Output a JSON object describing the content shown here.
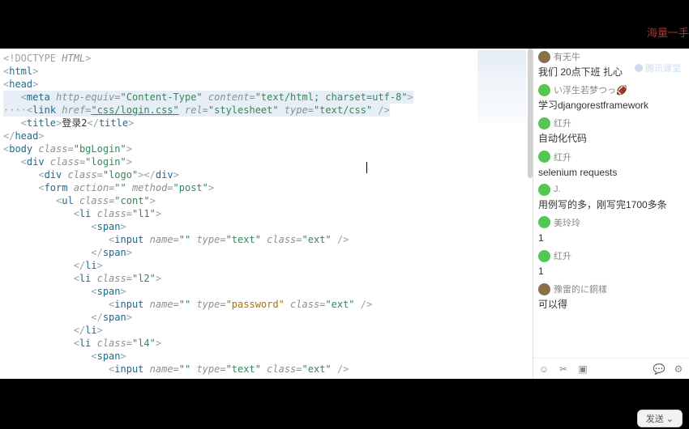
{
  "header": {
    "promo": "海量一手"
  },
  "sidebar_watermark": "腾讯课堂",
  "code": {
    "l1": {
      "r": "&lt;!DOCTYPE ",
      "doc": "HTML",
      "end": "&gt;"
    },
    "l2": {
      "open": "&lt;",
      "tag": "html",
      "close": "&gt;"
    },
    "l3": {
      "open": "&lt;",
      "tag": "head",
      "close": "&gt;"
    },
    "l4": {
      "open": "   &lt;",
      "tag": "meta ",
      "a1n": "http-equiv=",
      "a1v": "\"Content-Type\"",
      "a2n": " content=",
      "a2v": "\"text/html; charset=utf-8\"",
      "end": "&gt;"
    },
    "l5": {
      "pre": "····",
      "open": "&lt;",
      "tag": "link ",
      "a1n": "href=",
      "a1v": "\"css/login.css\"",
      "a2n": " rel=",
      "a2v": "\"stylesheet\"",
      "a3n": " type=",
      "a3v": "\"text/css\"",
      "end": " /&gt;"
    },
    "l6": {
      "open": "   &lt;",
      "tag": "title",
      "close": "&gt;",
      "text": "登录2",
      "openc": "&lt;/",
      "tagc": "title",
      "closec": "&gt;"
    },
    "l7": {
      "open": "&lt;/",
      "tag": "head",
      "close": "&gt;"
    },
    "l8": {
      "open": "&lt;",
      "tag": "body ",
      "a1n": "class=",
      "a1v": "\"bgLogin\"",
      "close": "&gt;"
    },
    "l9": {
      "open": "   &lt;",
      "tag": "div ",
      "a1n": "class=",
      "a1v": "\"login\"",
      "close": "&gt;"
    },
    "l10": {
      "open": "      &lt;",
      "tag": "div ",
      "a1n": "class=",
      "a1v": "\"logo\"",
      "close": "&gt;",
      "openc": "&lt;/",
      "tagc": "div",
      "closec": "&gt;"
    },
    "l11": {
      "open": "      &lt;",
      "tag": "form ",
      "a1n": "action=",
      "a1v": "\"\"",
      "a2n": " method=",
      "a2v": "\"post\"",
      "close": "&gt;"
    },
    "l12": {
      "open": "         &lt;",
      "tag": "ul ",
      "a1n": "class=",
      "a1v": "\"cont\"",
      "close": "&gt;"
    },
    "l13": {
      "open": "            &lt;",
      "tag": "li ",
      "a1n": "class=",
      "a1v": "\"l1\"",
      "close": "&gt;"
    },
    "l14": {
      "open": "               &lt;",
      "tag": "span",
      "close": "&gt;"
    },
    "l15": {
      "open": "                  &lt;",
      "tag": "input ",
      "a1n": "name=",
      "a1v": "\"\"",
      "a2n": " type=",
      "a2v": "\"text\"",
      "a3n": " class=",
      "a3v": "\"ext\"",
      "end": " /&gt;"
    },
    "l16": {
      "open": "               &lt;/",
      "tag": "span",
      "close": "&gt;"
    },
    "l17": {
      "open": "            &lt;/",
      "tag": "li",
      "close": "&gt;"
    },
    "l18": {
      "open": "            &lt;",
      "tag": "li ",
      "a1n": "class=",
      "a1v": "\"l2\"",
      "close": "&gt;"
    },
    "l19": {
      "open": "               &lt;",
      "tag": "span",
      "close": "&gt;"
    },
    "l20": {
      "open": "                  &lt;",
      "tag": "input ",
      "a1n": "name=",
      "a1v": "\"\"",
      "a2n": " type=",
      "a2v": "\"password\"",
      "a3n": " class=",
      "a3v": "\"ext\"",
      "end": " /&gt;"
    },
    "l21": {
      "open": "               &lt;/",
      "tag": "span",
      "close": "&gt;"
    },
    "l22": {
      "open": "            &lt;/",
      "tag": "li",
      "close": "&gt;"
    },
    "l23": {
      "open": "            &lt;",
      "tag": "li ",
      "a1n": "class=",
      "a1v": "\"l4\"",
      "close": "&gt;"
    },
    "l24": {
      "open": "               &lt;",
      "tag": "span",
      "close": "&gt;"
    },
    "l25": {
      "open": "                  &lt;",
      "tag": "input ",
      "a1n": "name=",
      "a1v": "\"\"",
      "a2n": " type=",
      "a2v": "\"text\"",
      "a3n": " class=",
      "a3v": "\"ext\"",
      "end": " /&gt;"
    }
  },
  "chat": {
    "messages": [
      {
        "avatar": "av-brown",
        "name": "有无牛",
        "text": "我们 20点下班 扎心"
      },
      {
        "avatar": "av-green",
        "name": "い浮生若梦つっ🏈",
        "text": "学习djangorestframework"
      },
      {
        "avatar": "av-green",
        "name": "红升",
        "text": "自动化代码"
      },
      {
        "avatar": "av-green",
        "name": "红升",
        "text": "selenium  requests"
      },
      {
        "avatar": "av-green",
        "name": "J.",
        "text": "用例写的多，刚写完1700多条"
      },
      {
        "avatar": "av-green",
        "name": "美玲玲",
        "text": "1"
      },
      {
        "avatar": "av-green",
        "name": "红升",
        "text": "1"
      },
      {
        "avatar": "av-brown",
        "name": "豫雷的に銅樣",
        "text": "可以得"
      }
    ],
    "send_label": "发送"
  }
}
